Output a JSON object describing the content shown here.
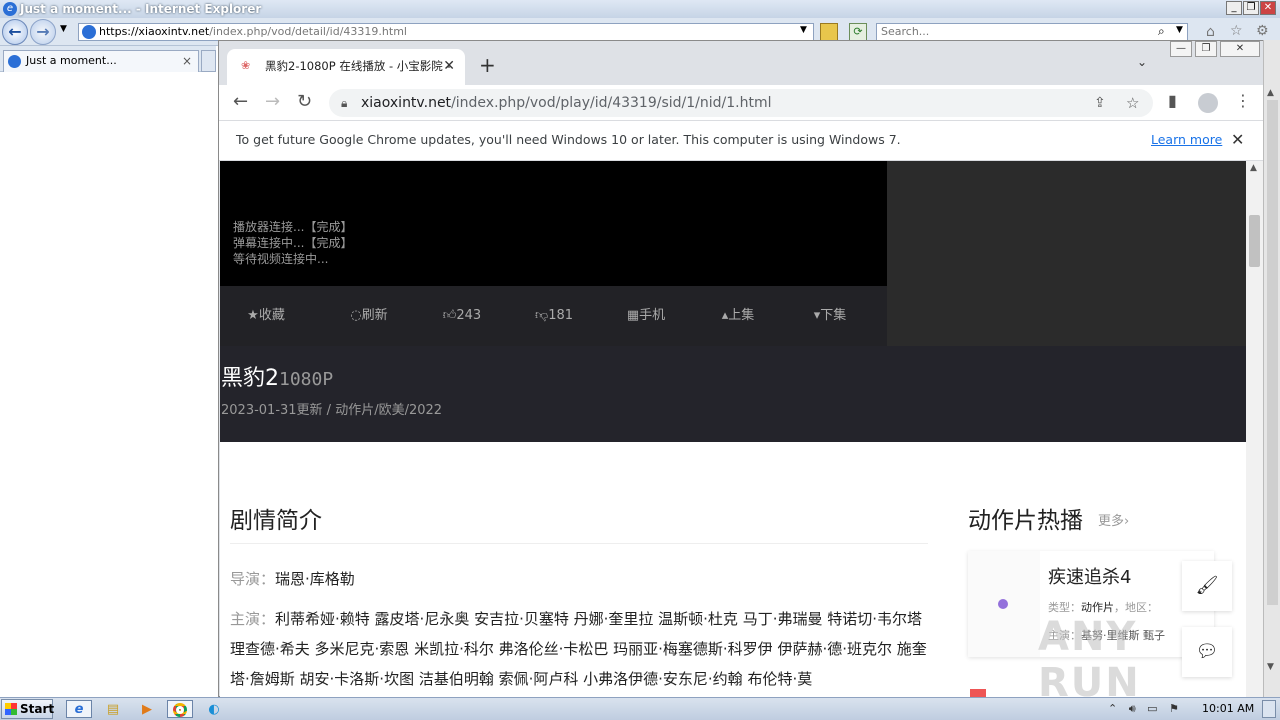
{
  "ie": {
    "title": "Just a moment... - Internet Explorer",
    "url_prefix": "https://xiaoxintv.net",
    "url_path": "/index.php/vod/detail/id/43319.html",
    "search_placeholder": "Search...",
    "tab_label": "Just a moment...",
    "tab_close": "×"
  },
  "chrome": {
    "tab_title": "黑豹2-1080P 在线播放 - 小宝影院 -",
    "tab_close": "✕",
    "new_tab": "+",
    "url_host": "xiaoxintv.net",
    "url_path": "/index.php/vod/play/id/43319/sid/1/nid/1.html",
    "infobar_text": "To get future Google Chrome updates, you'll need Windows 10 or later. This computer is using Windows 7.",
    "infobar_link": "Learn more",
    "infobar_close": "✕"
  },
  "player": {
    "log_lines": [
      "播放器连接...【完成】",
      "弹幕连接中...【完成】",
      "等待视频连接中..."
    ],
    "controls": {
      "favorite": "★收藏",
      "refresh": "刷新",
      "likes": "243",
      "dislikes": "181",
      "mobile": "手机",
      "prev": "上集",
      "next": "下集"
    }
  },
  "video": {
    "title": "黑豹2",
    "quality": "1080P",
    "meta": "2023-01-31更新 / 动作片/欧美/2022"
  },
  "intro": {
    "heading": "剧情简介",
    "director_label": "导演：",
    "director": "瑞恩·库格勒",
    "cast_label": "主演：",
    "cast": "利蒂希娅·赖特 露皮塔·尼永奥 安吉拉·贝塞特 丹娜·奎里拉 温斯顿·杜克 马丁·弗瑞曼 特诺切·韦尔塔 理查德·希夫 多米尼克·索恩 米凯拉·科尔 弗洛伦丝·卡松巴 玛丽亚·梅塞德斯·科罗伊 伊萨赫·德·班克尔 施奎塔·詹姆斯 胡安·卡洛斯·坎图 洁基伯明翰 索佩·阿卢科 小弗洛伊德·安东尼·约翰 布伦特·莫"
  },
  "hot": {
    "title": "动作片热播",
    "more": "更多›",
    "item_name": "疾速追杀4",
    "item_type_label": "类型：",
    "item_type": "动作片",
    "item_region_label": "，地区：",
    "item_cast_label": "主演：",
    "item_cast": "基努·里维斯 甄子"
  },
  "watermark": "ANY RUN",
  "taskbar": {
    "start": "Start",
    "clock": "10:01 AM"
  },
  "colors": {
    "player_bg": "#000000",
    "info_bg": "#24242b",
    "accent_dot": "#9370db",
    "link": "#1a73e8"
  }
}
